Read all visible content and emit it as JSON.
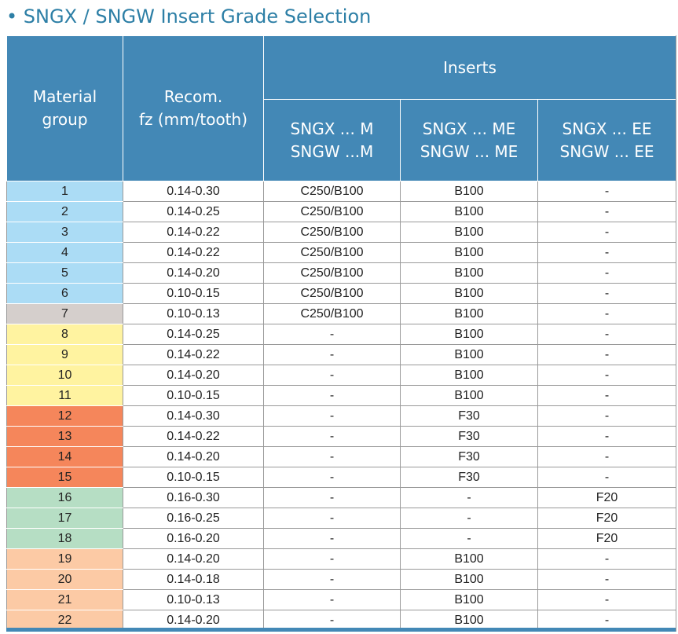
{
  "title": "• SNGX / SNGW Insert Grade Selection",
  "table": {
    "header": {
      "material_group": [
        "Material",
        "group"
      ],
      "recom_fz": [
        "Recom.",
        "fz (mm/tooth)"
      ],
      "inserts": "Inserts",
      "insert_columns": [
        [
          "SNGX ... M",
          "SNGW ...M"
        ],
        [
          "SNGX ... ME",
          "SNGW ... ME"
        ],
        [
          "SNGX ... EE",
          "SNGW ... EE"
        ]
      ]
    },
    "group_colors": {
      "blue": "#abdcf5",
      "gray": "#d5cfcc",
      "yellow": "#fff3a0",
      "orange": "#f5865b",
      "green": "#b6dec4",
      "peach": "#fccaa5"
    },
    "rows": [
      {
        "group": "1",
        "color": "blue",
        "fz": "0.14-0.30",
        "m": "C250/B100",
        "me": "B100",
        "ee": "-"
      },
      {
        "group": "2",
        "color": "blue",
        "fz": "0.14-0.25",
        "m": "C250/B100",
        "me": "B100",
        "ee": "-"
      },
      {
        "group": "3",
        "color": "blue",
        "fz": "0.14-0.22",
        "m": "C250/B100",
        "me": "B100",
        "ee": "-"
      },
      {
        "group": "4",
        "color": "blue",
        "fz": "0.14-0.22",
        "m": "C250/B100",
        "me": "B100",
        "ee": "-"
      },
      {
        "group": "5",
        "color": "blue",
        "fz": "0.14-0.20",
        "m": "C250/B100",
        "me": "B100",
        "ee": "-"
      },
      {
        "group": "6",
        "color": "blue",
        "fz": "0.10-0.15",
        "m": "C250/B100",
        "me": "B100",
        "ee": "-"
      },
      {
        "group": "7",
        "color": "gray",
        "fz": "0.10-0.13",
        "m": "C250/B100",
        "me": "B100",
        "ee": "-"
      },
      {
        "group": "8",
        "color": "yellow",
        "fz": "0.14-0.25",
        "m": "-",
        "me": "B100",
        "ee": "-"
      },
      {
        "group": "9",
        "color": "yellow",
        "fz": "0.14-0.22",
        "m": "-",
        "me": "B100",
        "ee": "-"
      },
      {
        "group": "10",
        "color": "yellow",
        "fz": "0.14-0.20",
        "m": "-",
        "me": "B100",
        "ee": "-"
      },
      {
        "group": "11",
        "color": "yellow",
        "fz": "0.10-0.15",
        "m": "-",
        "me": "B100",
        "ee": "-"
      },
      {
        "group": "12",
        "color": "orange",
        "fz": "0.14-0.30",
        "m": "-",
        "me": "F30",
        "ee": "-"
      },
      {
        "group": "13",
        "color": "orange",
        "fz": "0.14-0.22",
        "m": "-",
        "me": "F30",
        "ee": "-"
      },
      {
        "group": "14",
        "color": "orange",
        "fz": "0.14-0.20",
        "m": "-",
        "me": "F30",
        "ee": "-"
      },
      {
        "group": "15",
        "color": "orange",
        "fz": "0.10-0.15",
        "m": "-",
        "me": "F30",
        "ee": "-"
      },
      {
        "group": "16",
        "color": "green",
        "fz": "0.16-0.30",
        "m": "-",
        "me": "-",
        "ee": "F20"
      },
      {
        "group": "17",
        "color": "green",
        "fz": "0.16-0.25",
        "m": "-",
        "me": "-",
        "ee": "F20"
      },
      {
        "group": "18",
        "color": "green",
        "fz": "0.16-0.20",
        "m": "-",
        "me": "-",
        "ee": "F20"
      },
      {
        "group": "19",
        "color": "peach",
        "fz": "0.14-0.20",
        "m": "-",
        "me": "B100",
        "ee": "-"
      },
      {
        "group": "20",
        "color": "peach",
        "fz": "0.14-0.18",
        "m": "-",
        "me": "B100",
        "ee": "-"
      },
      {
        "group": "21",
        "color": "peach",
        "fz": "0.10-0.13",
        "m": "-",
        "me": "B100",
        "ee": "-"
      },
      {
        "group": "22",
        "color": "peach",
        "fz": "0.14-0.20",
        "m": "-",
        "me": "B100",
        "ee": "-"
      }
    ]
  }
}
